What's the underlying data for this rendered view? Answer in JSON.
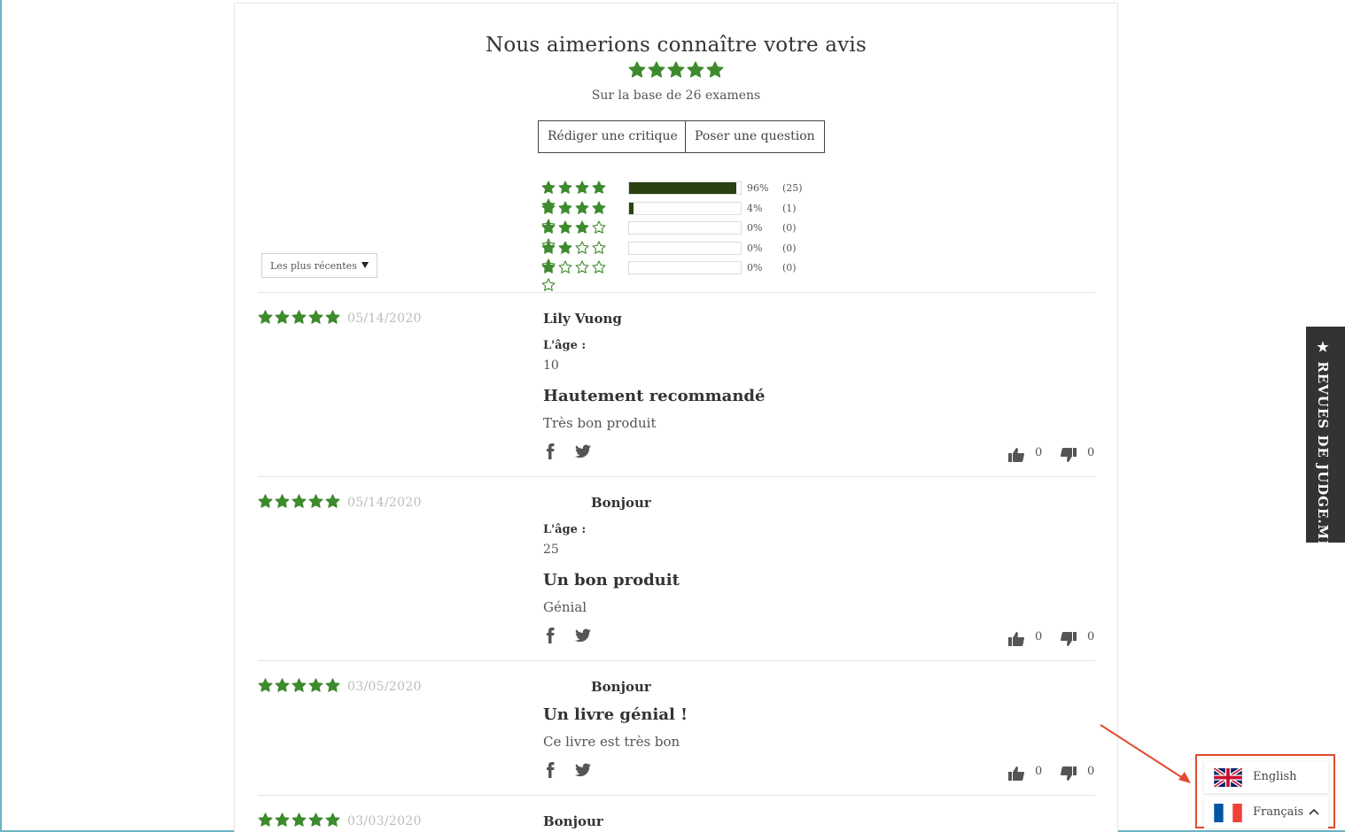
{
  "header": {
    "title": "Nous aimerions connaître votre avis",
    "subtitle": "Sur la base de 26 examens",
    "average_rating": 5,
    "write_review_label": "Rédiger une critique",
    "ask_question_label": "Poser une question"
  },
  "histogram": [
    {
      "stars": 5,
      "fill": 0.96,
      "percent": "96%",
      "count": "(25)"
    },
    {
      "stars": 4,
      "fill": 0.04,
      "percent": "4%",
      "count": "(1)"
    },
    {
      "stars": 3,
      "fill": 0,
      "percent": "0%",
      "count": "(0)"
    },
    {
      "stars": 2,
      "fill": 0,
      "percent": "0%",
      "count": "(0)"
    },
    {
      "stars": 1,
      "fill": 0,
      "percent": "0%",
      "count": "(0)"
    }
  ],
  "sort": {
    "selected": "Les plus récentes"
  },
  "reviews": [
    {
      "stars": 5,
      "date": "05/14/2020",
      "author": "Lily Vuong",
      "question_label": "L'âge :",
      "question_value": "10",
      "title": "Hautement recommandé",
      "body": "Très bon produit",
      "upvotes": "0",
      "downvotes": "0"
    },
    {
      "stars": 5,
      "date": "05/14/2020",
      "author": "Bonjour",
      "question_label": "L'âge :",
      "question_value": "25",
      "title": "Un bon produit",
      "body": "Génial",
      "upvotes": "0",
      "downvotes": "0"
    },
    {
      "stars": 5,
      "date": "03/05/2020",
      "author": "Bonjour",
      "title": "Un livre génial !",
      "body": "Ce livre est très bon",
      "upvotes": "0",
      "downvotes": "0"
    },
    {
      "stars": 5,
      "date": "03/03/2020",
      "author": "Bonjour"
    }
  ],
  "side_tab": {
    "label": "★ REVUES DE JUDGE.ME"
  },
  "language_switcher": {
    "options": [
      {
        "label": "English",
        "flag": "uk-flag-icon"
      },
      {
        "label": "Français",
        "flag": "france-flag-icon"
      }
    ]
  },
  "colors": {
    "star_green": "#3e8a2e",
    "bar_fill": "#2a4113",
    "highlight_red": "#e24a2f",
    "side_tab_bg": "#333333"
  },
  "icons": [
    "star-icon",
    "facebook-icon",
    "twitter-icon",
    "thumbs-up-icon",
    "thumbs-down-icon",
    "chevron-up-icon",
    "caret-down-icon",
    "uk-flag-icon",
    "france-flag-icon"
  ]
}
